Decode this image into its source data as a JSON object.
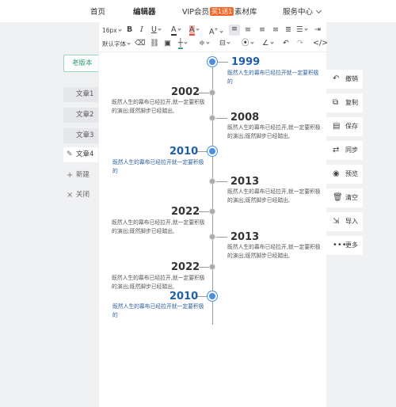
{
  "nav": {
    "home": "首页",
    "editor": "编辑器",
    "vip": "VIP会员",
    "vip_badge": "买1送1",
    "materials": "素材库",
    "service": "服务中心"
  },
  "sidebar": {
    "old_version": "老版本",
    "articles": [
      "文章1",
      "文章2",
      "文章3",
      "文章4"
    ],
    "new_label": "新建",
    "close_label": "关闭"
  },
  "toolbar": {
    "font_size": "16px",
    "font_family": "默认字体"
  },
  "timeline": [
    {
      "year": "1999",
      "side": "right",
      "style": "big",
      "desc": "既然人生的幕布已经拉开就一定要积极的"
    },
    {
      "year": "2002",
      "side": "left",
      "style": "small",
      "desc": "既然人生的幕布已经拉开,就一定要积极的演出;既然脚步已经踏出,"
    },
    {
      "year": "2008",
      "side": "right",
      "style": "small",
      "desc": "既然人生的幕布已经拉开,就一定要积极的演出;既然脚步已经踏出,"
    },
    {
      "year": "2010",
      "side": "left",
      "style": "big",
      "desc": "既然人生的幕布已经拉开就一定要积极的"
    },
    {
      "year": "2013",
      "side": "right",
      "style": "small",
      "desc": "既然人生的幕布已经拉开,就一定要积极的演出;既然脚步已经踏出,"
    },
    {
      "year": "2022",
      "side": "left",
      "style": "small",
      "desc": "既然人生的幕布已经拉开,就一定要积极的演出;既然脚步已经踏出,"
    },
    {
      "year": "2013",
      "side": "right",
      "style": "small",
      "desc": "既然人生的幕布已经拉开,就一定要积极的演出;既然脚步已经踏出,"
    },
    {
      "year": "2022",
      "side": "left",
      "style": "small",
      "desc": "既然人生的幕布已经拉开,就一定要积极的演出;既然脚步已经踏出,"
    },
    {
      "year": "2010",
      "side": "left",
      "style": "big",
      "desc": "既然人生的幕布已经拉开就一定要积极的"
    }
  ],
  "right_panel": {
    "undo": "撤销",
    "copy": "复制",
    "save": "保存",
    "sync": "同步",
    "preview": "预览",
    "clear": "清空",
    "import": "导入",
    "more": "更多"
  },
  "colors": {
    "accent_blue": "#4a8fe0",
    "year_blue": "#1d5ea6",
    "vip_orange": "#f56a2a",
    "old_btn_green": "#2f9a74"
  }
}
